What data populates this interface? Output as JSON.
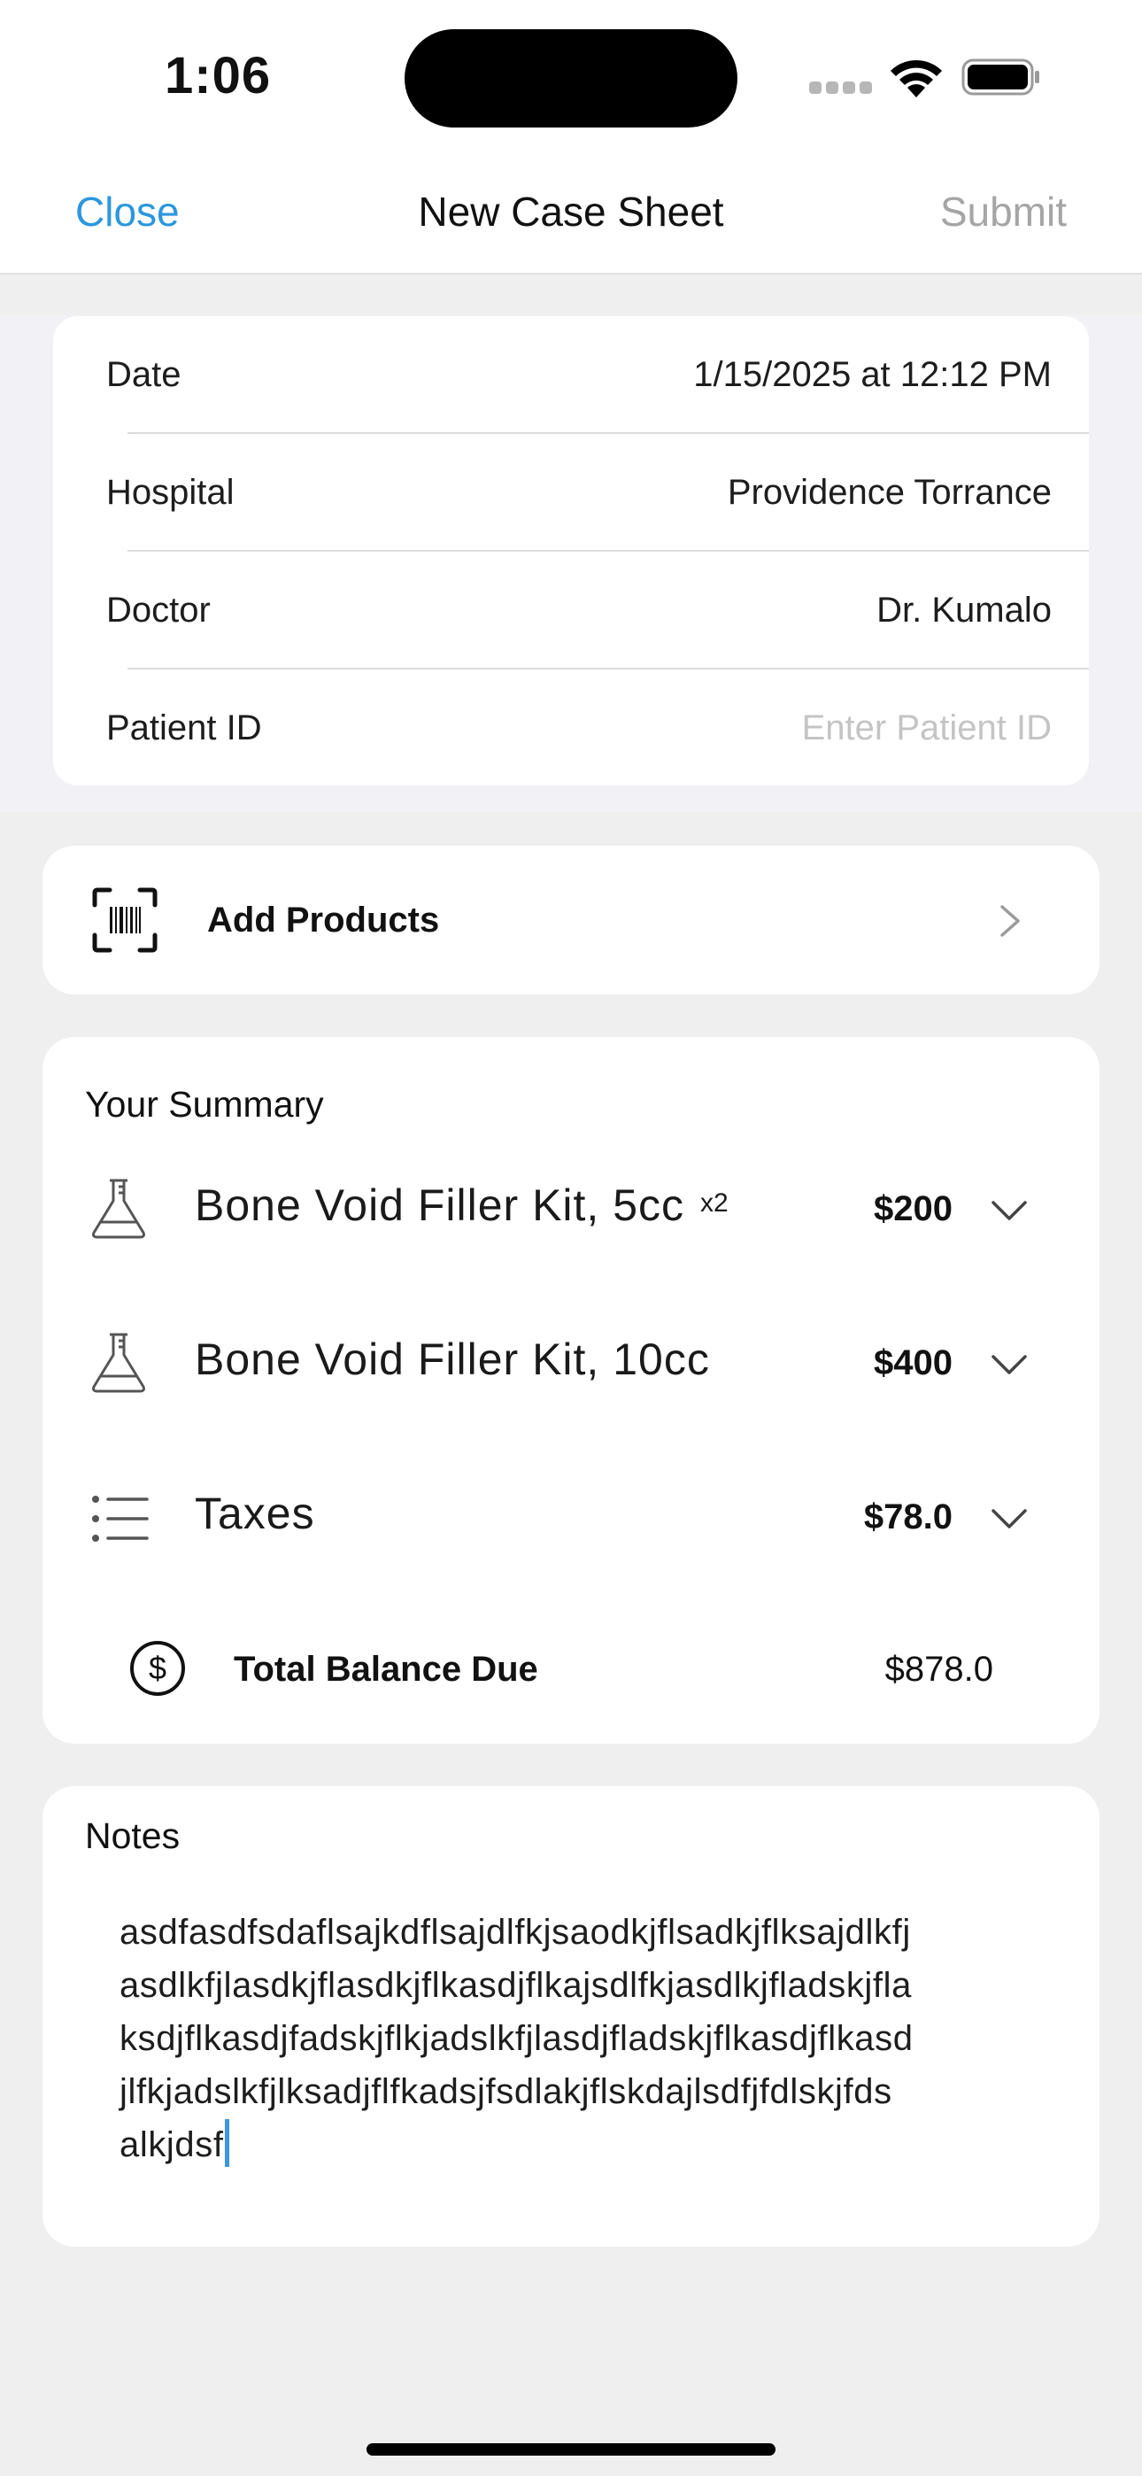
{
  "status_bar": {
    "time": "1:06",
    "icons": [
      "cellular-signal-icon",
      "wifi-icon",
      "battery-icon"
    ]
  },
  "nav": {
    "close_label": "Close",
    "title": "New Case Sheet",
    "submit_label": "Submit"
  },
  "form": {
    "rows": [
      {
        "label": "Date",
        "value": "1/15/2025 at 12:12 PM"
      },
      {
        "label": "Hospital",
        "value": "Providence Torrance"
      },
      {
        "label": "Doctor",
        "value": "Dr. Kumalo"
      },
      {
        "label": "Patient ID",
        "value": "",
        "placeholder": "Enter Patient ID"
      }
    ]
  },
  "add_products": {
    "label": "Add Products",
    "icon": "barcode-scan-icon"
  },
  "summary": {
    "title": "Your Summary",
    "items": [
      {
        "name": "Bone Void Filler Kit, 5cc",
        "qty": "x2",
        "price": "$200",
        "icon": "flask-icon"
      },
      {
        "name": "Bone Void Filler Kit, 10cc",
        "qty": "",
        "price": "$400",
        "icon": "flask-icon"
      },
      {
        "name": "Taxes",
        "qty": "",
        "price": "$78.0",
        "icon": "list-icon"
      }
    ],
    "total_label": "Total Balance Due",
    "total_value": "$878.0"
  },
  "notes": {
    "title": "Notes",
    "text": "asdfasdfsdaflsajkdflsajdlfkjsaodkjflsadkjflksajdlkfj\nasdlkfjlasdkjflasdkjflkasdjflkajsdlfkjasdlkjfladskjfla\nksdjflkasdjfadskjflkjadslkfjlasdjfladskjflkasdjflkasd\njlfkjadslkfjlksadjflfkadsjfsdlakjflskdajlsdfjfdlskjfds\nalkjdsf"
  },
  "colors": {
    "accent": "#2b97dd",
    "disabled": "#a5a5a5",
    "background": "#efefef",
    "card": "#ffffff"
  }
}
